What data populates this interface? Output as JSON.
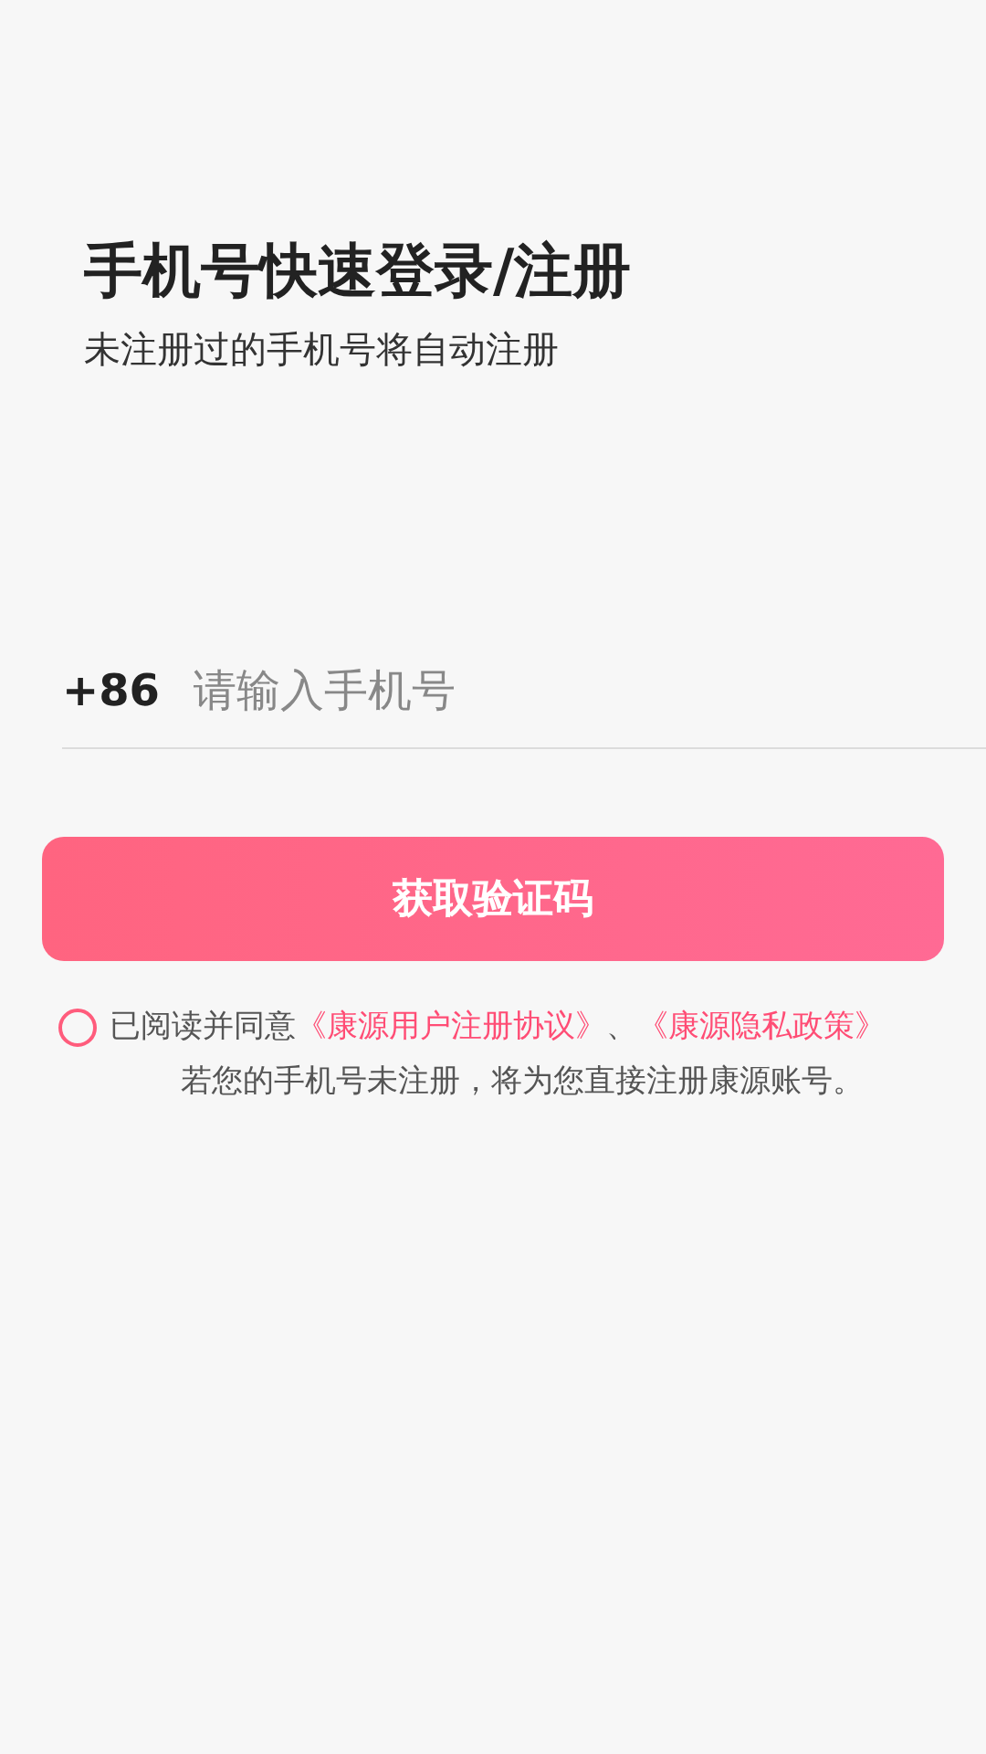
{
  "header": {
    "title": "手机号快速登录/注册",
    "subtitle": "未注册过的手机号将自动注册"
  },
  "phone": {
    "country_code": "+86",
    "placeholder": "请输入手机号"
  },
  "submit_button": "获取验证码",
  "agreement": {
    "checked": false,
    "prefix": "已阅读并同意",
    "links": [
      "《康源用户注册协议》",
      "《康源隐私政策》"
    ],
    "separator": "、",
    "note": "若您的手机号未注册，将为您直接注册康源账号。"
  }
}
